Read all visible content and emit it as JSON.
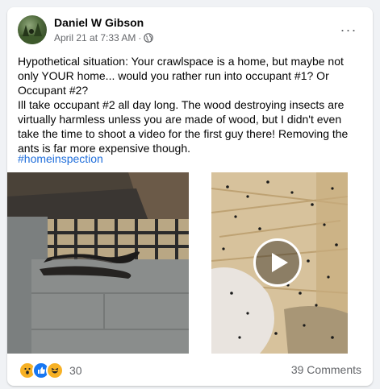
{
  "post": {
    "author": "Daniel W Gibson",
    "date": "April 21 at 7:33 AM",
    "separator": "·",
    "more_label": "···",
    "paragraph1": "Hypothetical situation: Your crawlspace is a home, but maybe not only YOUR home... would you rather run into occupant #1? Or Occupant #2?",
    "paragraph2": "Ill take occupant #2 all day long. The wood destroying insects are virtually harmless unless you are made of wood, but I didn't even take the time to shoot a video for the first guy there! Removing the ants is far more expensive though.",
    "hashtag": "#homeinspection"
  },
  "reactions": {
    "icons": [
      "wow-icon",
      "like-icon",
      "haha-icon"
    ],
    "count": "30"
  },
  "comments_label": "39 Comments",
  "colors": {
    "link": "#216fdb",
    "secondary_text": "#65676b",
    "like_blue": "#1877f2",
    "emoji_yellow": "#f7b125"
  }
}
